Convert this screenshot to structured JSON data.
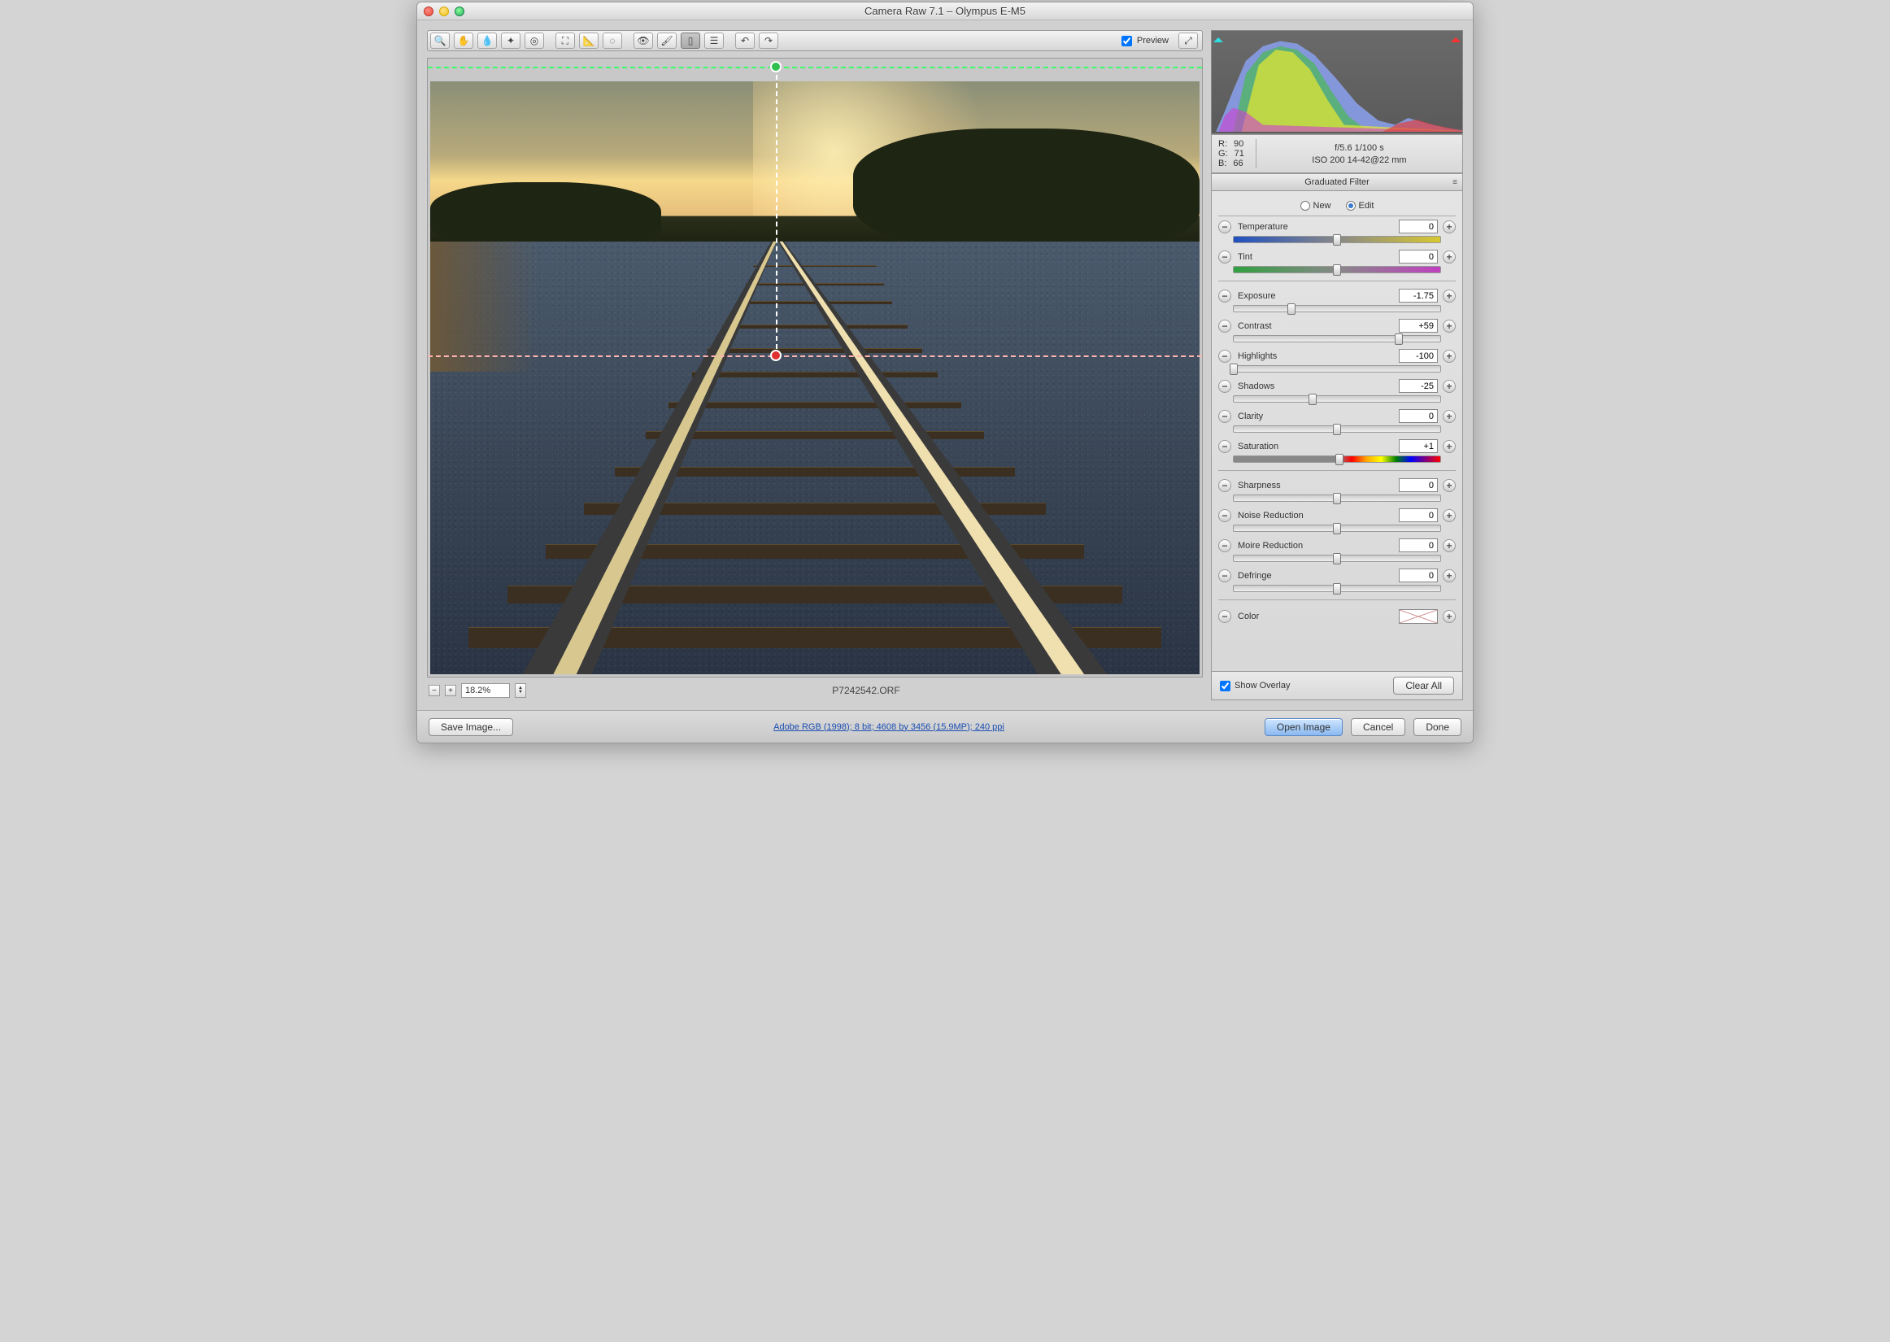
{
  "window": {
    "title": "Camera Raw 7.1  –  Olympus E-M5"
  },
  "toolbar": {
    "preview_label": "Preview",
    "preview_checked": true
  },
  "zoom": {
    "value": "18.2%"
  },
  "file": {
    "name": "P7242542.ORF"
  },
  "rgb": {
    "r_label": "R:",
    "r": "90",
    "g_label": "G:",
    "g": "71",
    "b_label": "B:",
    "b": "66"
  },
  "exif": {
    "line1": "f/5.6   1/100 s",
    "line2": "ISO 200    14-42@22 mm"
  },
  "panel": {
    "title": "Graduated Filter",
    "mode_new": "New",
    "mode_edit": "Edit",
    "show_overlay": "Show Overlay",
    "clear_all": "Clear All",
    "color_label": "Color"
  },
  "sliders": [
    {
      "label": "Temperature",
      "value": "0",
      "pos": 50,
      "track": "temp"
    },
    {
      "label": "Tint",
      "value": "0",
      "pos": 50,
      "track": "tint"
    },
    {
      "label": "Exposure",
      "value": "-1.75",
      "pos": 28,
      "track": ""
    },
    {
      "label": "Contrast",
      "value": "+59",
      "pos": 80,
      "track": ""
    },
    {
      "label": "Highlights",
      "value": "-100",
      "pos": 0,
      "track": ""
    },
    {
      "label": "Shadows",
      "value": "-25",
      "pos": 38,
      "track": ""
    },
    {
      "label": "Clarity",
      "value": "0",
      "pos": 50,
      "track": ""
    },
    {
      "label": "Saturation",
      "value": "+1",
      "pos": 51,
      "track": "sat"
    },
    {
      "label": "Sharpness",
      "value": "0",
      "pos": 50,
      "track": ""
    },
    {
      "label": "Noise Reduction",
      "value": "0",
      "pos": 50,
      "track": ""
    },
    {
      "label": "Moire Reduction",
      "value": "0",
      "pos": 50,
      "track": ""
    },
    {
      "label": "Defringe",
      "value": "0",
      "pos": 50,
      "track": ""
    }
  ],
  "separators_after": [
    1,
    7
  ],
  "buttons": {
    "save_image": "Save Image...",
    "open_image": "Open Image",
    "cancel": "Cancel",
    "done": "Done"
  },
  "link": "Adobe RGB (1998); 8 bit; 4608 by 3456 (15.9MP); 240 ppi"
}
